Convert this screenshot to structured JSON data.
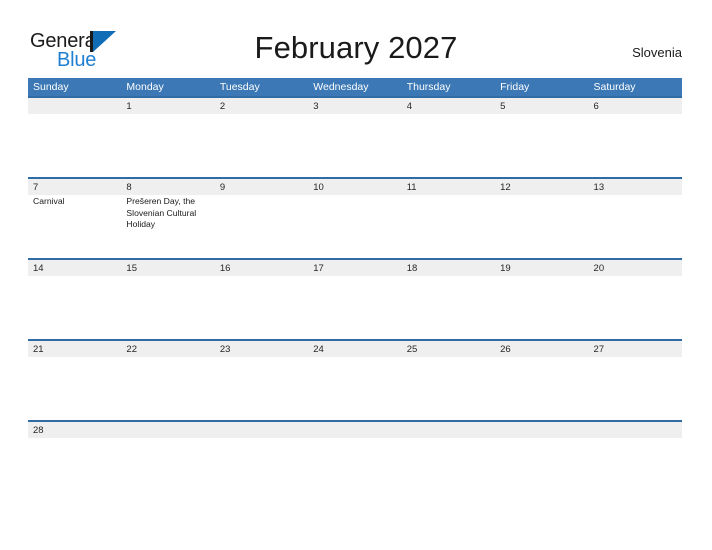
{
  "brand": {
    "name_part1": "General",
    "name_part2": "Blue",
    "logo_icon": "general-blue-triangle-logo",
    "accent_color": "#0f6cb5",
    "blue_text_color": "#1f7fd1"
  },
  "header": {
    "title": "February 2027",
    "country": "Slovenia"
  },
  "theme": {
    "header_band": "#3b78b5",
    "row_border": "#2f6ca5",
    "date_band": "#efefef",
    "text": "#1a1a1a"
  },
  "calendar": {
    "weekdays": [
      "Sunday",
      "Monday",
      "Tuesday",
      "Wednesday",
      "Thursday",
      "Friday",
      "Saturday"
    ],
    "weeks": [
      {
        "days": [
          {
            "num": "",
            "events": []
          },
          {
            "num": "1",
            "events": []
          },
          {
            "num": "2",
            "events": []
          },
          {
            "num": "3",
            "events": []
          },
          {
            "num": "4",
            "events": []
          },
          {
            "num": "5",
            "events": []
          },
          {
            "num": "6",
            "events": []
          }
        ]
      },
      {
        "days": [
          {
            "num": "7",
            "events": [
              "Carnival"
            ]
          },
          {
            "num": "8",
            "events": [
              "Prešeren Day, the Slovenian Cultural Holiday"
            ]
          },
          {
            "num": "9",
            "events": []
          },
          {
            "num": "10",
            "events": []
          },
          {
            "num": "11",
            "events": []
          },
          {
            "num": "12",
            "events": []
          },
          {
            "num": "13",
            "events": []
          }
        ]
      },
      {
        "days": [
          {
            "num": "14",
            "events": []
          },
          {
            "num": "15",
            "events": []
          },
          {
            "num": "16",
            "events": []
          },
          {
            "num": "17",
            "events": []
          },
          {
            "num": "18",
            "events": []
          },
          {
            "num": "19",
            "events": []
          },
          {
            "num": "20",
            "events": []
          }
        ]
      },
      {
        "days": [
          {
            "num": "21",
            "events": []
          },
          {
            "num": "22",
            "events": []
          },
          {
            "num": "23",
            "events": []
          },
          {
            "num": "24",
            "events": []
          },
          {
            "num": "25",
            "events": []
          },
          {
            "num": "26",
            "events": []
          },
          {
            "num": "27",
            "events": []
          }
        ]
      },
      {
        "days": [
          {
            "num": "28",
            "events": []
          },
          {
            "num": "",
            "events": []
          },
          {
            "num": "",
            "events": []
          },
          {
            "num": "",
            "events": []
          },
          {
            "num": "",
            "events": []
          },
          {
            "num": "",
            "events": []
          },
          {
            "num": "",
            "events": []
          }
        ]
      }
    ]
  }
}
